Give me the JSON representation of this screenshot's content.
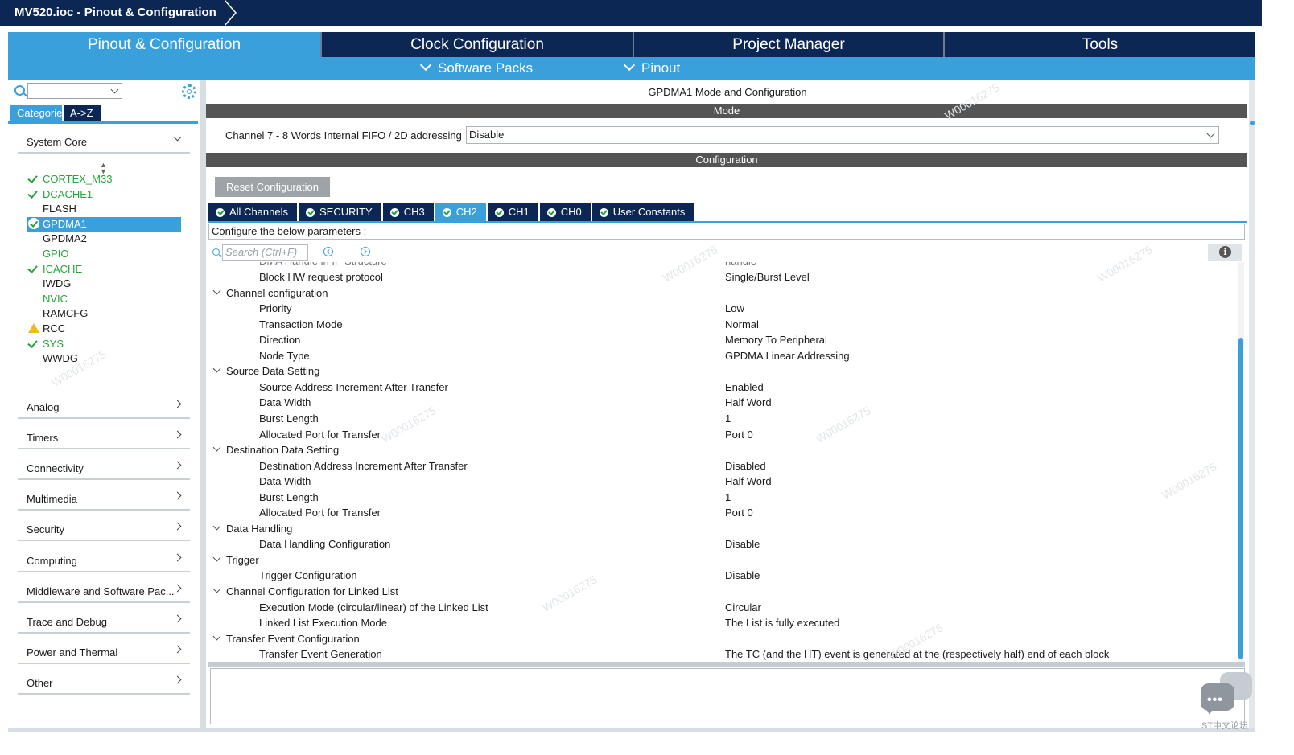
{
  "window": {
    "title": "MV520.ioc - Pinout & Configuration"
  },
  "main_tabs": [
    {
      "label": "Pinout & Configuration"
    },
    {
      "label": "Clock Configuration"
    },
    {
      "label": "Project Manager"
    },
    {
      "label": "Tools"
    }
  ],
  "sub_menu": {
    "software_packs": "Software Packs",
    "pinout": "Pinout"
  },
  "sidebar": {
    "search_value": "",
    "tabs": {
      "categories": "Categories",
      "az": "A->Z"
    },
    "system_core_label": "System Core",
    "peripherals": [
      {
        "label": "CORTEX_M33",
        "status": "ok"
      },
      {
        "label": "DCACHE1",
        "status": "ok"
      },
      {
        "label": "FLASH",
        "status": "none"
      },
      {
        "label": "GPDMA1",
        "status": "selected"
      },
      {
        "label": "GPDMA2",
        "status": "none"
      },
      {
        "label": "GPIO",
        "status": "green"
      },
      {
        "label": "ICACHE",
        "status": "ok"
      },
      {
        "label": "IWDG",
        "status": "none"
      },
      {
        "label": "NVIC",
        "status": "green"
      },
      {
        "label": "RAMCFG",
        "status": "none"
      },
      {
        "label": "RCC",
        "status": "warning"
      },
      {
        "label": "SYS",
        "status": "ok"
      },
      {
        "label": "WWDG",
        "status": "none"
      }
    ],
    "categories": [
      {
        "label": "Analog"
      },
      {
        "label": "Timers"
      },
      {
        "label": "Connectivity"
      },
      {
        "label": "Multimedia"
      },
      {
        "label": "Security"
      },
      {
        "label": "Computing"
      },
      {
        "label": "Middleware and Software Pac..."
      },
      {
        "label": "Trace and Debug"
      },
      {
        "label": "Power and Thermal"
      },
      {
        "label": "Other"
      }
    ]
  },
  "content": {
    "title": "GPDMA1 Mode and Configuration",
    "mode_header": "Mode",
    "channel_label": "Channel 7  - 8 Words Internal FIFO / 2D addressing",
    "channel_value": "Disable",
    "config_header": "Configuration",
    "reset_button": "Reset Configuration",
    "config_tabs": [
      {
        "label": "All Channels",
        "active": false
      },
      {
        "label": "SECURITY",
        "active": false
      },
      {
        "label": "CH3",
        "active": false
      },
      {
        "label": "CH2",
        "active": true
      },
      {
        "label": "CH1",
        "active": false
      },
      {
        "label": "CH0",
        "active": false
      },
      {
        "label": "User Constants",
        "active": false
      }
    ],
    "hint": "Configure the below parameters :",
    "search_placeholder": "Search (Ctrl+F)",
    "info_label": "i",
    "params": [
      {
        "name": "DMA Handle in IP Structure",
        "value": "handle",
        "level": 1,
        "clip": true
      },
      {
        "name": "Block HW request protocol",
        "value": "Single/Burst Level",
        "level": 1
      },
      {
        "name": "Channel configuration",
        "value": "",
        "level": 0
      },
      {
        "name": "Priority",
        "value": "Low",
        "level": 1
      },
      {
        "name": "Transaction Mode",
        "value": "Normal",
        "level": 1
      },
      {
        "name": "Direction",
        "value": "Memory To Peripheral",
        "level": 1
      },
      {
        "name": "Node Type",
        "value": "GPDMA Linear Addressing",
        "level": 1
      },
      {
        "name": "Source Data Setting",
        "value": "",
        "level": 0
      },
      {
        "name": "Source Address Increment After Transfer",
        "value": "Enabled",
        "level": 1
      },
      {
        "name": "Data Width",
        "value": "Half Word",
        "level": 1
      },
      {
        "name": "Burst Length",
        "value": "1",
        "level": 1
      },
      {
        "name": "Allocated Port for Transfer",
        "value": "Port 0",
        "level": 1
      },
      {
        "name": "Destination Data Setting",
        "value": "",
        "level": 0
      },
      {
        "name": "Destination Address Increment After Transfer",
        "value": "Disabled",
        "level": 1
      },
      {
        "name": "Data Width",
        "value": "Half Word",
        "level": 1
      },
      {
        "name": "Burst Length",
        "value": "1",
        "level": 1
      },
      {
        "name": "Allocated Port for Transfer",
        "value": "Port 0",
        "level": 1
      },
      {
        "name": "Data Handling",
        "value": "",
        "level": 0
      },
      {
        "name": "Data Handling Configuration",
        "value": "Disable",
        "level": 1
      },
      {
        "name": "Trigger",
        "value": "",
        "level": 0
      },
      {
        "name": "Trigger Configuration",
        "value": "Disable",
        "level": 1
      },
      {
        "name": "Channel Configuration for Linked List",
        "value": "",
        "level": 0
      },
      {
        "name": "Execution Mode (circular/linear) of the Linked List",
        "value": "Circular",
        "level": 1
      },
      {
        "name": "Linked List Execution Mode",
        "value": "The List is fully executed",
        "level": 1
      },
      {
        "name": "Transfer Event Configuration",
        "value": "",
        "level": 0
      },
      {
        "name": "Transfer Event Generation",
        "value": "The TC (and the HT) event is generated at the (respectively half) end of each block",
        "level": 1
      }
    ]
  },
  "watermark": {
    "text": "W00016275",
    "logo": "ST中文论坛"
  }
}
